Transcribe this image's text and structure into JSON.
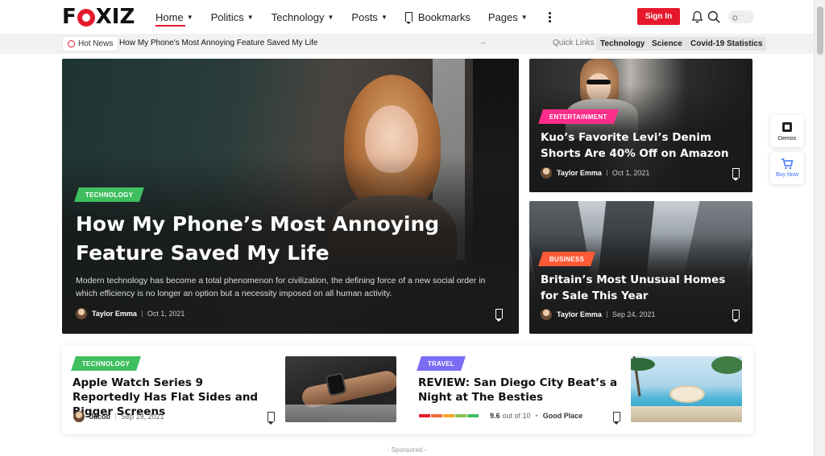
{
  "brand": {
    "logo_left": "F",
    "logo_right": "XIZ",
    "accent": "#e6192c"
  },
  "nav": {
    "items": [
      {
        "label": "Home",
        "active": true,
        "dropdown": true
      },
      {
        "label": "Politics",
        "dropdown": true
      },
      {
        "label": "Technology",
        "dropdown": true
      },
      {
        "label": "Posts",
        "dropdown": true
      },
      {
        "label": "Bookmarks",
        "dropdown": false
      },
      {
        "label": "Pages",
        "dropdown": true
      }
    ],
    "signin_label": "Sign In"
  },
  "ticker": {
    "hot_label": "Hot News",
    "headline": "How My Phone's Most Annoying Feature Saved My Life",
    "quick_label": "Quick Links",
    "quick_links": [
      "Technology",
      "Science",
      "Covid-19 Statistics"
    ]
  },
  "hero": {
    "category": "TECHNOLOGY",
    "category_color": "#3fbf5f",
    "title": "How My Phone’s Most Annoying Feature Saved My Life",
    "excerpt": "Modern technology has become a total phenomenon for civilization, the defining force of a new social order in which efficiency is no longer an option but a necessity imposed on all human activity.",
    "author": "Taylor Emma",
    "date": "Oct 1, 2021"
  },
  "side_cards": [
    {
      "category": "ENTERTAINMENT",
      "category_color": "#ff2d8a",
      "title": "Kuo’s Favorite Levi’s Denim Shorts Are 40% Off on Amazon",
      "author": "Taylor Emma",
      "date": "Oct 1, 2021"
    },
    {
      "category": "BUSINESS",
      "category_color": "#ff5a36",
      "title": "Britain’s Most Unusual Homes for Sale This Year",
      "author": "Taylor Emma",
      "date": "Sep 24, 2021"
    }
  ],
  "floating": {
    "demos_label": "Demos",
    "buy_label": "Buy Now"
  },
  "bottom_cards": [
    {
      "category": "TECHNOLOGY",
      "category_color": "#3fbf5f",
      "title": "Apple Watch Series 9 Reportedly Has Flat Sides and Bigger Screens",
      "author": "Jacob",
      "date": "Sep 19, 2021"
    },
    {
      "category": "TRAVEL",
      "category_color": "#7b6cf6",
      "title": "REVIEW: San Diego City Beat’s a Night at The Besties",
      "score": "9.6",
      "score_suffix": "out of 10",
      "verdict": "Good Place",
      "rating": 0.96
    }
  ],
  "sponsored_label": "- Sponsored -"
}
